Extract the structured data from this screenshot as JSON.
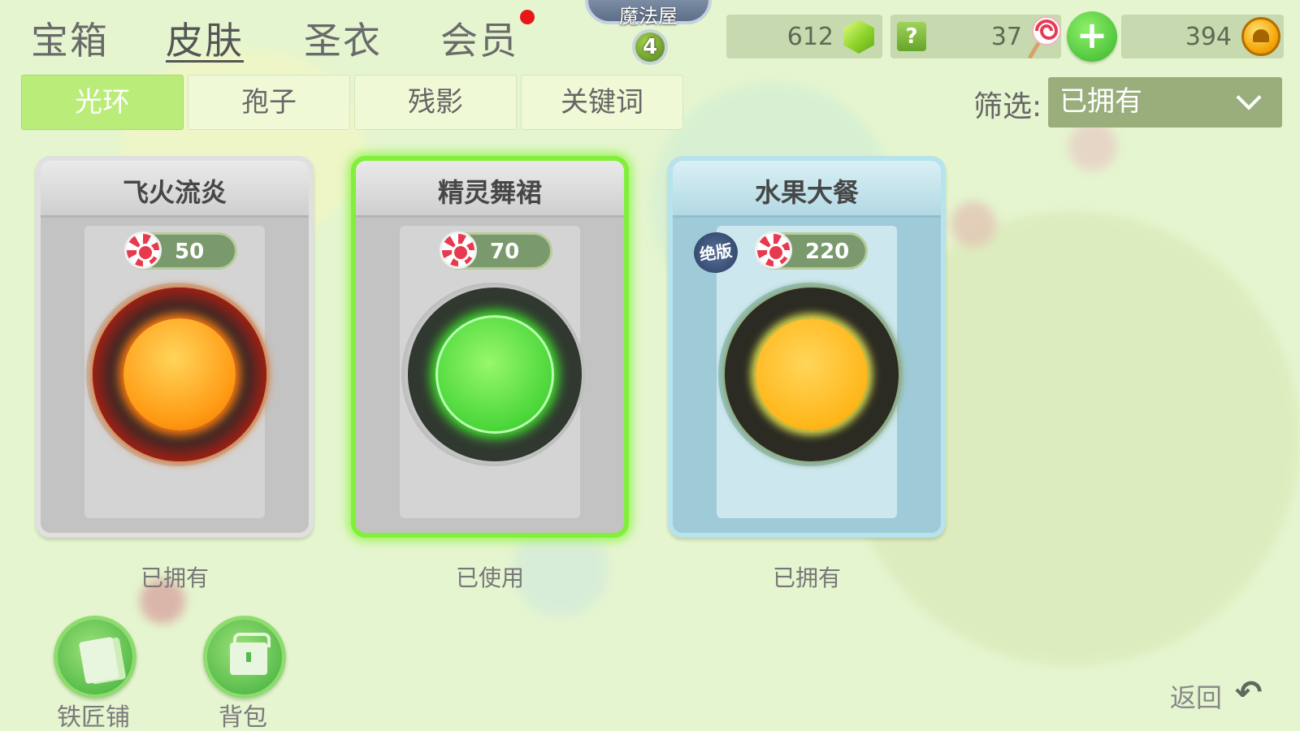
{
  "nav": {
    "tabs": [
      {
        "label": "宝箱"
      },
      {
        "label": "皮肤"
      },
      {
        "label": "圣衣"
      },
      {
        "label": "会员"
      }
    ],
    "active_tab": "皮肤"
  },
  "magic_house": {
    "label": "魔法屋",
    "level": "4"
  },
  "currency": {
    "gems": "612",
    "candy": "37",
    "coins": "394",
    "help_label": "?",
    "plus_label": "+"
  },
  "sub_tabs": [
    {
      "label": "光环"
    },
    {
      "label": "孢子"
    },
    {
      "label": "残影"
    },
    {
      "label": "关键词"
    }
  ],
  "active_sub_tab": "光环",
  "filter": {
    "label": "筛选:",
    "value": "已拥有"
  },
  "cards": [
    {
      "name": "飞火流炎",
      "price": "50",
      "status": "已拥有",
      "halo": "fire"
    },
    {
      "name": "精灵舞裙",
      "price": "70",
      "status": "已使用",
      "halo": "spirit",
      "selected": true
    },
    {
      "name": "水果大餐",
      "price": "220",
      "status": "已拥有",
      "halo": "fruit",
      "badge": "绝版"
    }
  ],
  "bottom": {
    "blacksmith_label": "铁匠铺",
    "backpack_label": "背包",
    "back_label": "返回"
  },
  "colors": {
    "background": "#e5f5cf",
    "active_tab": "#b9ec79",
    "selected_glow": "#82ef3a",
    "notification": "#e8171b"
  }
}
